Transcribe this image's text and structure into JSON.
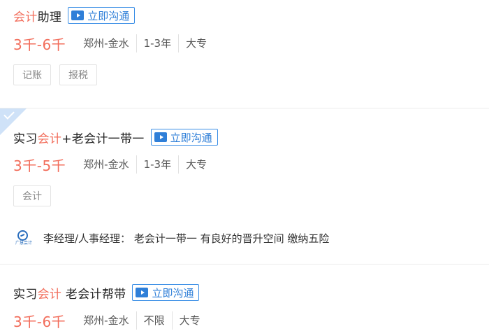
{
  "jobs": [
    {
      "title_prefix": "",
      "title_highlight": "会计",
      "title_suffix": "助理",
      "chat_label": "立即沟通",
      "salary": "3千-6千",
      "location": "郑州-金水",
      "experience": "1-3年",
      "education": "大专",
      "tags": [
        "记账",
        "报税"
      ]
    },
    {
      "title_prefix": "实习",
      "title_highlight": "会计",
      "title_suffix": "+老会计一带一",
      "chat_label": "立即沟通",
      "salary": "3千-5千",
      "location": "郑州-金水",
      "experience": "1-3年",
      "education": "大专",
      "tags": [
        "会计"
      ],
      "recruiter_text": "李经理/人事经理： 老会计一带一 有良好的晋升空间 缴纳五险",
      "logo_text": "广慧会计"
    },
    {
      "title_prefix": "实习",
      "title_highlight": "会计",
      "title_suffix": " 老会计帮带",
      "chat_label": "立即沟通",
      "salary": "3千-6千",
      "location": "郑州-金水",
      "experience": "不限",
      "education": "大专"
    }
  ],
  "colors": {
    "highlight": "#f26d5b",
    "chat_blue": "#2f7fd8",
    "corner_badge": "#cfe2f8"
  },
  "icons": [
    "video-chat-icon",
    "checkmark-corner-icon",
    "company-logo"
  ]
}
